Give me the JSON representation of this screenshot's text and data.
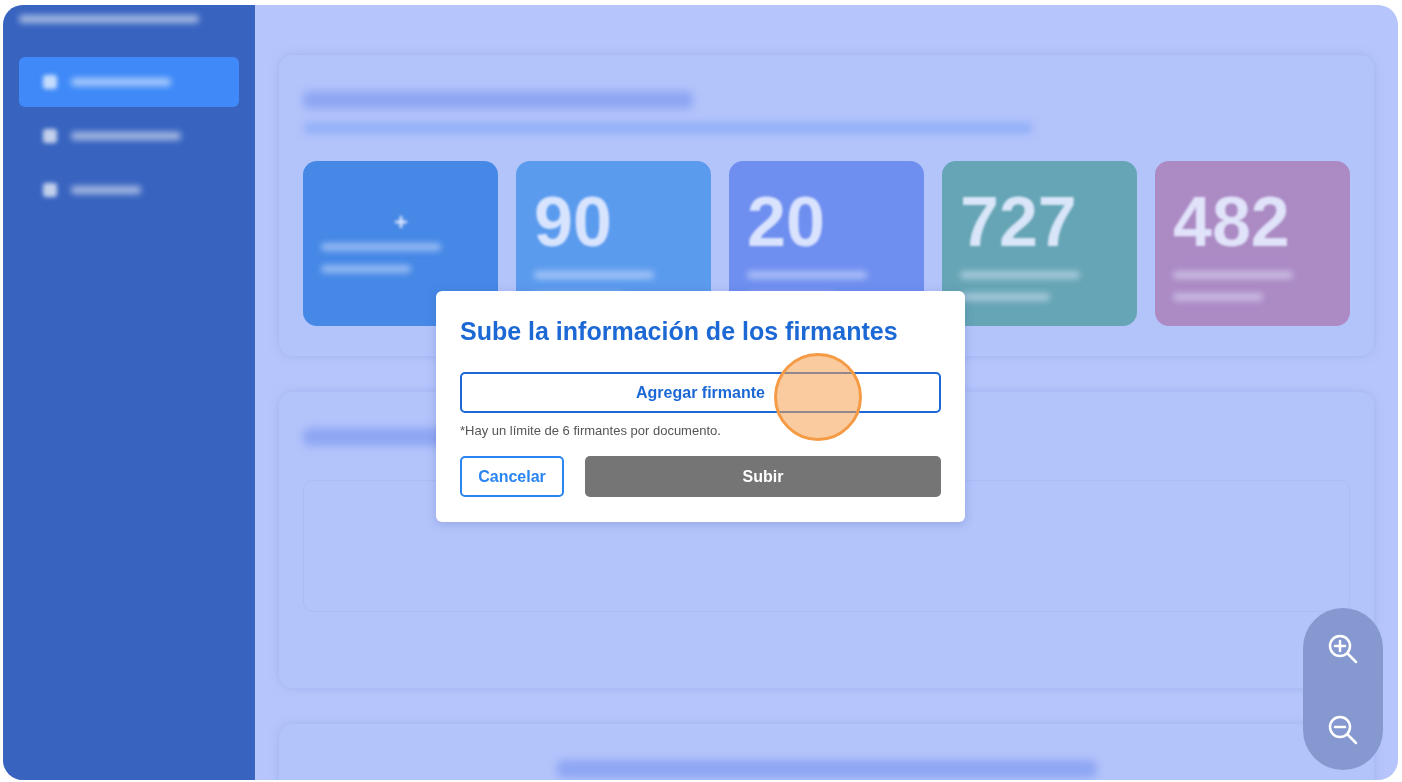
{
  "sidebar": {
    "items": [
      {
        "selected": true
      },
      {
        "selected": false
      },
      {
        "selected": false
      }
    ]
  },
  "stat_cards": [
    {
      "kind": "create",
      "color": "#4588e6"
    },
    {
      "kind": "count",
      "value": "90",
      "color": "#5b9bee"
    },
    {
      "kind": "count",
      "value": "20",
      "color": "#6f8ff0"
    },
    {
      "kind": "count",
      "value": "727",
      "color": "#65a5b5"
    },
    {
      "kind": "count",
      "value": "482",
      "color": "#ac8ac4"
    }
  ],
  "dialog": {
    "title": "Sube la información de los firmantes",
    "add_button": "Agregar firmante",
    "note": "*Hay un límite de 6 firmantes por documento.",
    "cancel_button": {
      "label": "Cancelar",
      "disabled": false
    },
    "submit_button": {
      "label": "Subir",
      "disabled": true
    }
  }
}
